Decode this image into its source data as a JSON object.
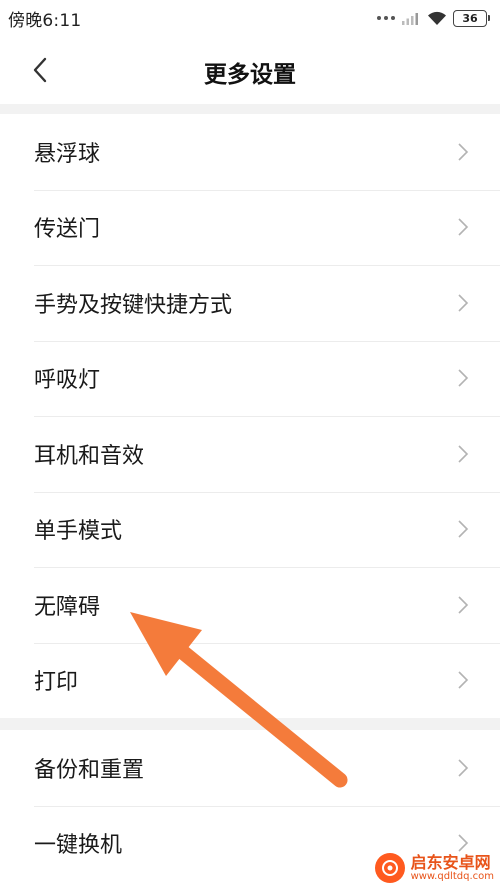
{
  "status_bar": {
    "time": "傍晚6:11",
    "battery": "36",
    "icons": [
      "more-dots-icon",
      "signal-icon",
      "wifi-icon",
      "battery-icon"
    ]
  },
  "header": {
    "title": "更多设置",
    "back_icon": "chevron-left-icon"
  },
  "group1": {
    "items": [
      {
        "label": "悬浮球"
      },
      {
        "label": "传送门"
      },
      {
        "label": "手势及按键快捷方式"
      },
      {
        "label": "呼吸灯"
      },
      {
        "label": "耳机和音效"
      },
      {
        "label": "单手模式"
      },
      {
        "label": "无障碍"
      },
      {
        "label": "打印"
      }
    ]
  },
  "group2": {
    "items": [
      {
        "label": "备份和重置"
      },
      {
        "label": "一键换机"
      }
    ]
  },
  "annotation": {
    "arrow_color": "#f47b3b",
    "target": "无障碍"
  },
  "watermark": {
    "name": "启东安卓网",
    "url": "www.qdltdq.com"
  },
  "colors": {
    "chevron": "#b3b3b3",
    "divider": "#ececec",
    "section_gap": "#f2f2f2"
  }
}
